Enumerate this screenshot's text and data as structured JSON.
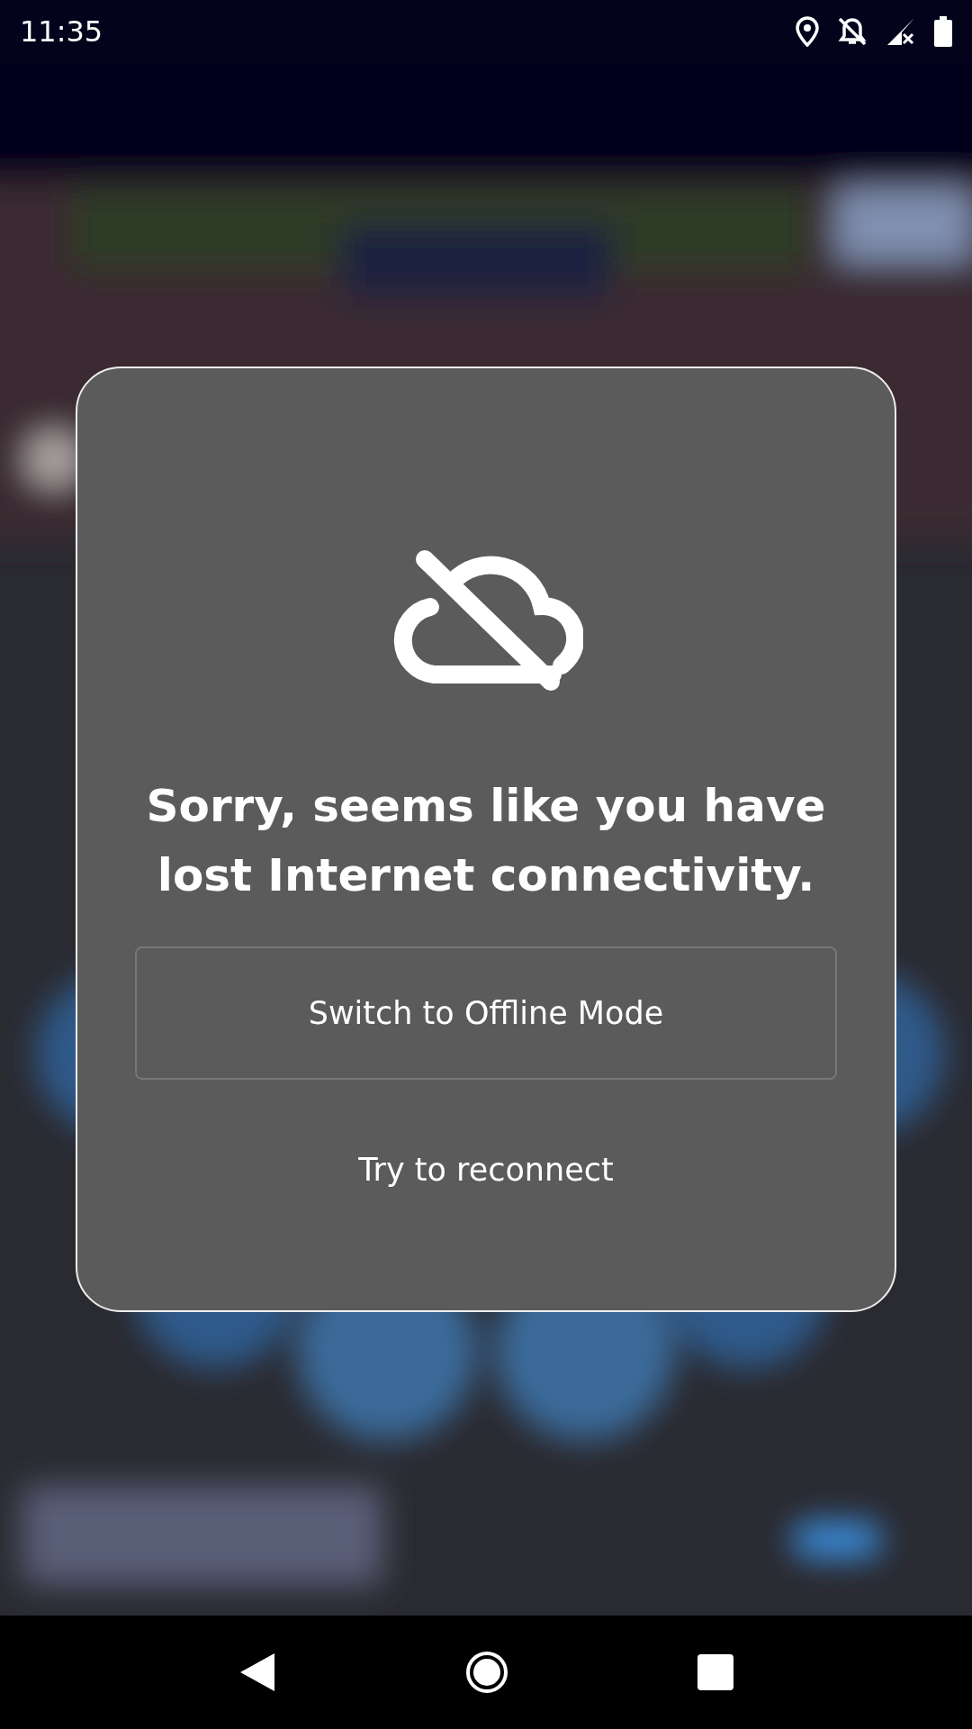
{
  "status_bar": {
    "time": "11:35"
  },
  "dialog": {
    "title": "Sorry, seems like you have lost Internet connectivity.",
    "buttons": [
      {
        "label": "Switch to Offline Mode",
        "kind": "outlined"
      },
      {
        "label": "Try to reconnect",
        "kind": "text"
      }
    ]
  }
}
